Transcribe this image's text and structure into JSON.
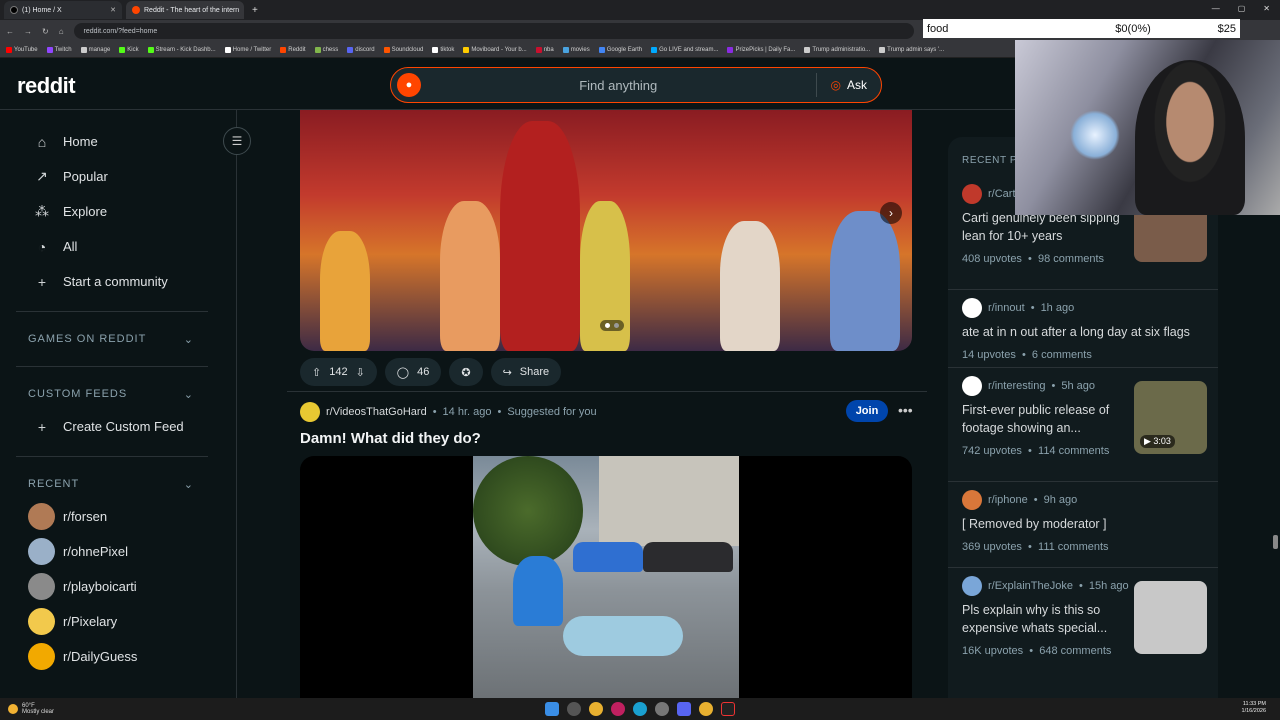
{
  "browser": {
    "tabs": [
      {
        "label": "(1) Home / X",
        "color": "#000000"
      },
      {
        "label": "Reddit - The heart of the intern",
        "color": "#ff4500"
      }
    ],
    "url": "reddit.com/?feed=home",
    "bookmarks": [
      {
        "label": "YouTube",
        "color": "#ff0000"
      },
      {
        "label": "Twitch",
        "color": "#9146ff"
      },
      {
        "label": "manage",
        "color": "#cccccc"
      },
      {
        "label": "Kick",
        "color": "#53fc18"
      },
      {
        "label": "Stream - Kick Dashb...",
        "color": "#53fc18"
      },
      {
        "label": "Home / Twitter",
        "color": "#ffffff"
      },
      {
        "label": "Reddit",
        "color": "#ff4500"
      },
      {
        "label": "chess",
        "color": "#81b64c"
      },
      {
        "label": "discord",
        "color": "#5865f2"
      },
      {
        "label": "Soundcloud",
        "color": "#ff5500"
      },
      {
        "label": "tiktok",
        "color": "#ffffff"
      },
      {
        "label": "Moviboard - Your b...",
        "color": "#ffcc00"
      },
      {
        "label": "nba",
        "color": "#c8102e"
      },
      {
        "label": "movies",
        "color": "#4aa3df"
      },
      {
        "label": "Google Earth",
        "color": "#4285f4"
      },
      {
        "label": "Go LIVE and stream...",
        "color": "#00aaff"
      },
      {
        "label": "PrizePicks | Daily Fa...",
        "color": "#8a2be2"
      },
      {
        "label": "Trump administratio...",
        "color": "#cccccc"
      },
      {
        "label": "Trump admin says '...",
        "color": "#cccccc"
      }
    ]
  },
  "overlay": {
    "label": "food",
    "amount": "$0(0%)",
    "goal": "$25"
  },
  "header": {
    "logo": "reddit",
    "search_placeholder": "Find anything",
    "ask_label": "Ask"
  },
  "sidebar": {
    "nav": [
      {
        "label": "Home",
        "icon": "home-icon",
        "glyph": "⌂"
      },
      {
        "label": "Popular",
        "icon": "popular-icon",
        "glyph": "↗"
      },
      {
        "label": "Explore",
        "icon": "explore-icon",
        "glyph": "⁂"
      },
      {
        "label": "All",
        "icon": "all-icon",
        "glyph": "◔"
      },
      {
        "label": "Start a community",
        "icon": "plus-icon",
        "glyph": "+"
      }
    ],
    "games_header": "GAMES ON REDDIT",
    "feeds_header": "CUSTOM FEEDS",
    "create_feed": "Create Custom Feed",
    "recent_header": "RECENT",
    "recent": [
      {
        "label": "r/forsen",
        "color": "#b07a55"
      },
      {
        "label": "r/ohnePixel",
        "color": "#9ab0c8"
      },
      {
        "label": "r/playboicarti",
        "color": "#8a8a8a"
      },
      {
        "label": "r/Pixelary",
        "color": "#f2c94c"
      },
      {
        "label": "r/DailyGuess",
        "color": "#f2a900"
      }
    ]
  },
  "feed": {
    "post1": {
      "upvotes": "142",
      "comments": "46",
      "share": "Share"
    },
    "post2": {
      "subreddit": "r/VideosThatGoHard",
      "time": "14 hr. ago",
      "suggested": "Suggested for you",
      "join": "Join",
      "title": "Damn! What did they do?"
    }
  },
  "recent_posts": {
    "header": "RECENT POSTS",
    "items": [
      {
        "sub": "r/Cart",
        "time": "",
        "title": "Carti genuinely been sipping lean for 10+ years",
        "upvotes": "408 upvotes",
        "comments": "98 comments",
        "icon_color": "#c0392b"
      },
      {
        "sub": "r/innout",
        "time": "1h ago",
        "title": "ate at in n out after a long day at six flags",
        "upvotes": "14 upvotes",
        "comments": "6 comments",
        "icon_color": "#ffffff"
      },
      {
        "sub": "r/interesting",
        "time": "5h ago",
        "title": "First-ever public release of footage showing an...",
        "upvotes": "742 upvotes",
        "comments": "114 comments",
        "icon_color": "#ffffff",
        "duration": "3:03"
      },
      {
        "sub": "r/iphone",
        "time": "9h ago",
        "title": "[ Removed by moderator ]",
        "upvotes": "369 upvotes",
        "comments": "111 comments",
        "icon_color": "#d9773a"
      },
      {
        "sub": "r/ExplainTheJoke",
        "time": "15h ago",
        "title": "Pls explain why is this so expensive whats special...",
        "upvotes": "16K upvotes",
        "comments": "648 comments",
        "icon_color": "#7aa6d8"
      }
    ]
  },
  "taskbar": {
    "temp": "60°F",
    "weather": "Mostly clear",
    "time": "11:33 PM",
    "date": "1/16/2026"
  }
}
